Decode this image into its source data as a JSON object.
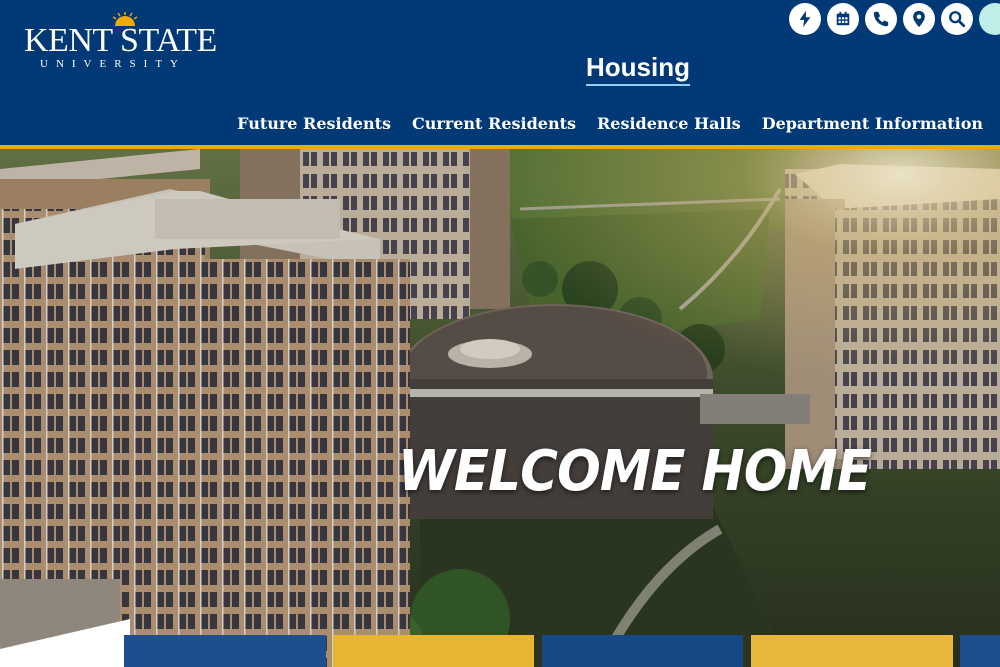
{
  "logo": {
    "name": "KENT STATE",
    "sub": "UNIVERSITY"
  },
  "utility_icons": [
    "bolt-icon",
    "calendar-icon",
    "phone-icon",
    "map-pin-icon",
    "search-icon"
  ],
  "site_title": "Housing",
  "nav": [
    "Future Residents",
    "Current Residents",
    "Residence Halls",
    "Department Information"
  ],
  "hero": {
    "headline": "WELCOME HOME"
  },
  "colors": {
    "navy": "#003976",
    "gold": "#efab00",
    "tile_blue": "#1d4f8f",
    "tile_gold": "#e7b52f"
  }
}
